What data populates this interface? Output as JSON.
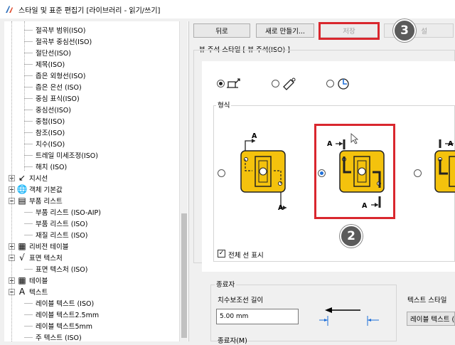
{
  "window": {
    "title": "스타일 및 표준 편집기 [라이브러리 - 읽기/쓰기]"
  },
  "tree": {
    "items": [
      {
        "label": "절곡부 범위(ISO)",
        "level": 2
      },
      {
        "label": "절곡부 중심선(ISO)",
        "level": 2
      },
      {
        "label": "절단선(ISO)",
        "level": 2
      },
      {
        "label": "제목(ISO)",
        "level": 2
      },
      {
        "label": "좁은 외형선(ISO)",
        "level": 2
      },
      {
        "label": "좁은 은선 (ISO)",
        "level": 2
      },
      {
        "label": "중심 표식(ISO)",
        "level": 2
      },
      {
        "label": "중심선(ISO)",
        "level": 2
      },
      {
        "label": "중첩(ISO)",
        "level": 2
      },
      {
        "label": "참조(ISO)",
        "level": 2
      },
      {
        "label": "치수(ISO)",
        "level": 2
      },
      {
        "label": "트레일 미세조정(ISO)",
        "level": 2
      },
      {
        "label": "해치 (ISO)",
        "level": 2
      },
      {
        "label": "지시선",
        "level": 1,
        "icon": "leader-icon",
        "glyph": "↙"
      },
      {
        "label": "객체 기본값",
        "level": 1,
        "icon": "globe-icon",
        "glyph": "🌐"
      },
      {
        "label": "부품 리스트",
        "level": 1,
        "icon": "parts-list-icon",
        "glyph": "▤",
        "open": true
      },
      {
        "label": "부품 리스트 (ISO-AIP)",
        "level": 2
      },
      {
        "label": "부품 리스트 (ISO)",
        "level": 2
      },
      {
        "label": "재질 리스트 (ISO)",
        "level": 2
      },
      {
        "label": "리비전 테이블",
        "level": 1,
        "icon": "revision-table-icon",
        "glyph": "▦"
      },
      {
        "label": "표면 텍스처",
        "level": 1,
        "icon": "surface-texture-icon",
        "glyph": "√",
        "open": true
      },
      {
        "label": "표면 텍스처 (ISO)",
        "level": 2
      },
      {
        "label": "테이블",
        "level": 1,
        "icon": "table-icon",
        "glyph": "▦"
      },
      {
        "label": "텍스트",
        "level": 1,
        "icon": "text-icon",
        "glyph": "A",
        "open": true
      },
      {
        "label": "레이블 텍스트 (ISO)",
        "level": 2
      },
      {
        "label": "레이블 텍스트2.5mm",
        "level": 2
      },
      {
        "label": "레이블 텍스트5mm",
        "level": 2
      },
      {
        "label": "주 텍스트 (ISO)",
        "level": 2
      }
    ]
  },
  "toolbar": {
    "back": "뒤로",
    "new": "새로 만들기...",
    "save": "저장",
    "reset": "설"
  },
  "panel": {
    "header": "뷰 주석 스타일 [ 뷰 주석(ISO) ]",
    "format_label": "형식",
    "show_all_lines": "전체 선 표시",
    "terminator_section": "종료자",
    "ext_line_length_label": "치수보조선 길이",
    "ext_line_length_value": "5.00 mm",
    "terminator_label": "종료자(M)",
    "text_style_label": "텍스트 스타일",
    "text_style_value": "레이블 텍스트 (ISO)"
  },
  "diagram_labels": {
    "a": "A"
  },
  "steps": {
    "two": "2",
    "three": "3"
  },
  "colors": {
    "highlight": "#d9272e",
    "badge": "#5b5b5b",
    "part_yellow": "#f4c20d",
    "radio_selected": "#1e6fd9"
  }
}
